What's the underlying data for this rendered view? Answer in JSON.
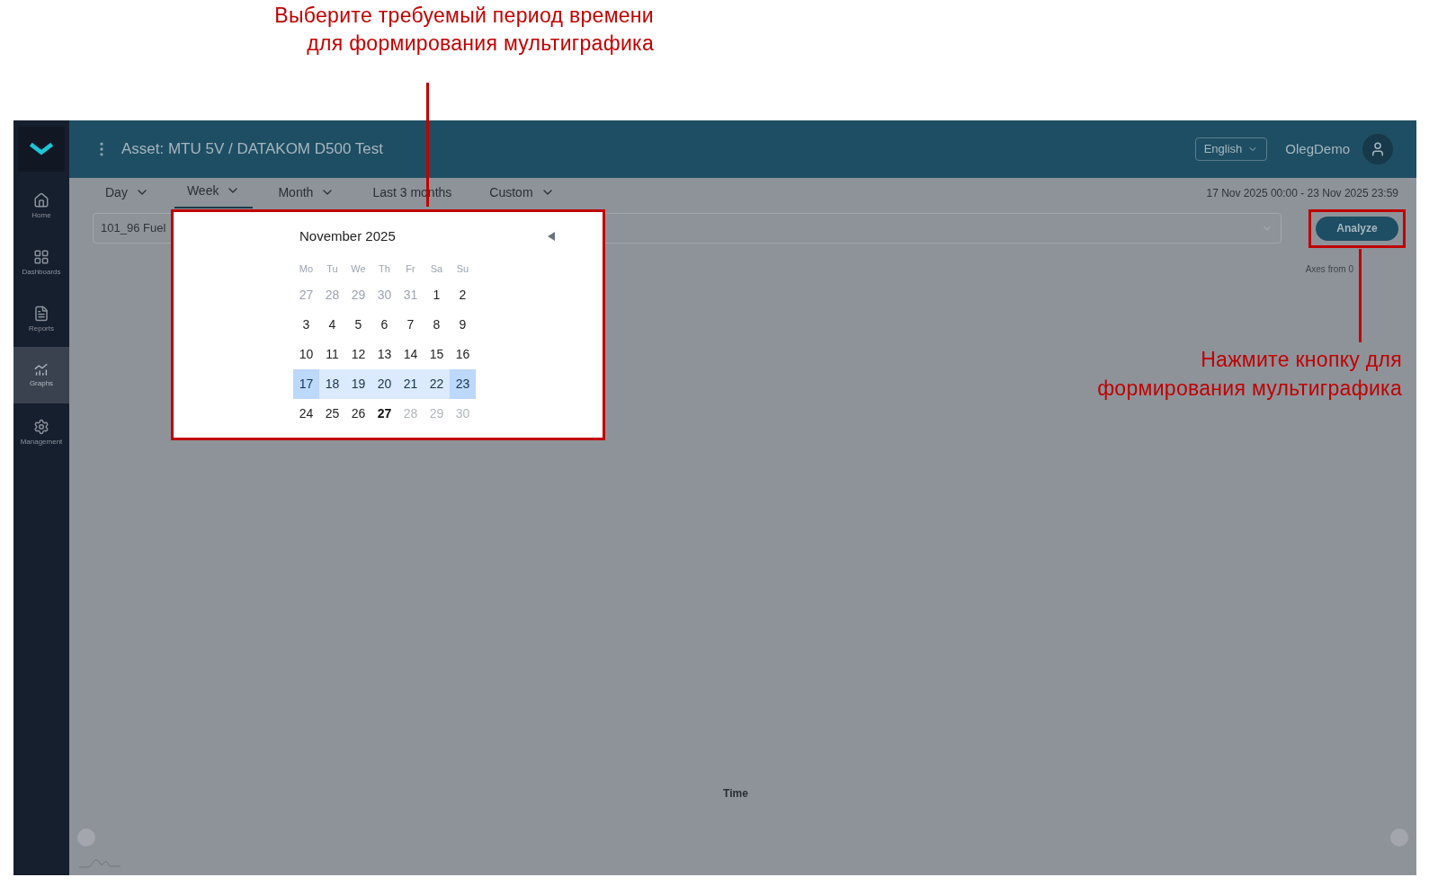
{
  "annotations": [
    {
      "lines": [
        "Выберите требуемый период времени",
        "для формирования мультиграфика"
      ]
    },
    {
      "lines": [
        "Нажмите кнопку для",
        "формирования мультиграфика"
      ]
    }
  ],
  "header": {
    "title": "Asset: MTU 5V / DATAKOM D500 Test",
    "language": "English",
    "user": "OlegDemo"
  },
  "sidebar": {
    "items": [
      {
        "label": "Home",
        "selected": false
      },
      {
        "label": "Dashboards",
        "selected": false
      },
      {
        "label": "Reports",
        "selected": false
      },
      {
        "label": "Graphs",
        "selected": true
      },
      {
        "label": "Management",
        "selected": false
      }
    ]
  },
  "tabs": [
    {
      "label": "Day",
      "selected": false,
      "has_menu": true
    },
    {
      "label": "Week",
      "selected": true,
      "has_menu": true
    },
    {
      "label": "Month",
      "selected": false,
      "has_menu": true
    },
    {
      "label": "Last 3 months",
      "selected": false,
      "has_menu": false
    },
    {
      "label": "Custom",
      "selected": false,
      "has_menu": true
    }
  ],
  "date_range": "17 Nov 2025 00:00 - 23 Nov 2025 23:59",
  "signal_select": {
    "value": "101_96 Fuel"
  },
  "analyze_button": "Analyze",
  "axes_option": "Axes from 0",
  "x_axis_label": "Time",
  "calendar": {
    "month": "November 2025",
    "weekdays": [
      "Mo",
      "Tu",
      "We",
      "Th",
      "Fr",
      "Sa",
      "Su"
    ],
    "weeks": [
      [
        {
          "day": "27",
          "kind": "outside",
          "selected": false,
          "range_end": false
        },
        {
          "day": "28",
          "kind": "outside",
          "selected": false,
          "range_end": false
        },
        {
          "day": "29",
          "kind": "outside",
          "selected": false,
          "range_end": false
        },
        {
          "day": "30",
          "kind": "outside",
          "selected": false,
          "range_end": false
        },
        {
          "day": "31",
          "kind": "outside",
          "selected": false,
          "range_end": false
        },
        {
          "day": "1",
          "kind": "day",
          "selected": false,
          "range_end": false
        },
        {
          "day": "2",
          "kind": "day",
          "selected": false,
          "range_end": false
        }
      ],
      [
        {
          "day": "3",
          "kind": "day",
          "selected": false,
          "range_end": false
        },
        {
          "day": "4",
          "kind": "day",
          "selected": false,
          "range_end": false
        },
        {
          "day": "5",
          "kind": "day",
          "selected": false,
          "range_end": false
        },
        {
          "day": "6",
          "kind": "day",
          "selected": false,
          "range_end": false
        },
        {
          "day": "7",
          "kind": "day",
          "selected": false,
          "range_end": false
        },
        {
          "day": "8",
          "kind": "day",
          "selected": false,
          "range_end": false
        },
        {
          "day": "9",
          "kind": "day",
          "selected": false,
          "range_end": false
        }
      ],
      [
        {
          "day": "10",
          "kind": "day",
          "selected": false,
          "range_end": false
        },
        {
          "day": "11",
          "kind": "day",
          "selected": false,
          "range_end": false
        },
        {
          "day": "12",
          "kind": "day",
          "selected": false,
          "range_end": false
        },
        {
          "day": "13",
          "kind": "day",
          "selected": false,
          "range_end": false
        },
        {
          "day": "14",
          "kind": "day",
          "selected": false,
          "range_end": false
        },
        {
          "day": "15",
          "kind": "day",
          "selected": false,
          "range_end": false
        },
        {
          "day": "16",
          "kind": "day",
          "selected": false,
          "range_end": false
        }
      ],
      [
        {
          "day": "17",
          "kind": "day",
          "selected": true,
          "range_end": true
        },
        {
          "day": "18",
          "kind": "day",
          "selected": true,
          "range_end": false
        },
        {
          "day": "19",
          "kind": "day",
          "selected": true,
          "range_end": false
        },
        {
          "day": "20",
          "kind": "day",
          "selected": true,
          "range_end": false
        },
        {
          "day": "21",
          "kind": "day",
          "selected": true,
          "range_end": false
        },
        {
          "day": "22",
          "kind": "day",
          "selected": true,
          "range_end": false
        },
        {
          "day": "23",
          "kind": "day",
          "selected": true,
          "range_end": true
        }
      ],
      [
        {
          "day": "24",
          "kind": "day",
          "selected": false,
          "range_end": false
        },
        {
          "day": "25",
          "kind": "day",
          "selected": false,
          "range_end": false
        },
        {
          "day": "26",
          "kind": "day",
          "selected": false,
          "range_end": false
        },
        {
          "day": "27",
          "kind": "today",
          "selected": false,
          "range_end": false
        },
        {
          "day": "28",
          "kind": "disabled",
          "selected": false,
          "range_end": false
        },
        {
          "day": "29",
          "kind": "disabled",
          "selected": false,
          "range_end": false
        },
        {
          "day": "30",
          "kind": "disabled",
          "selected": false,
          "range_end": false
        }
      ]
    ]
  }
}
